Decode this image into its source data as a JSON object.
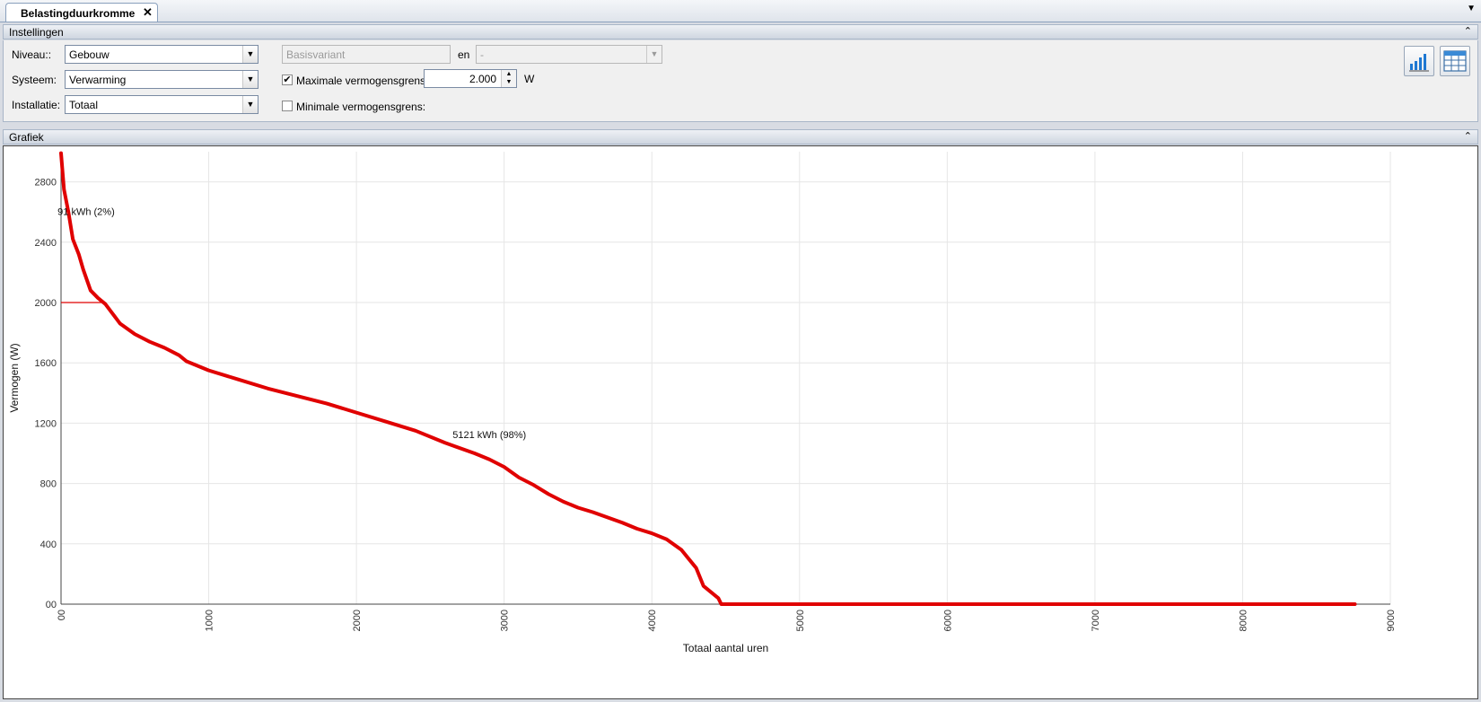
{
  "tab": {
    "label": "Belastingduurkromme",
    "close": "✕",
    "menu": "▼"
  },
  "settings": {
    "title": "Instellingen",
    "collapse": "⌃",
    "niveau_label": "Niveau::",
    "niveau_value": "Gebouw",
    "systeem_label": "Systeem:",
    "systeem_value": "Verwarming",
    "installatie_label": "Installatie:",
    "installatie_value": "Totaal",
    "variant_value": "Basisvariant",
    "en_label": "en",
    "compare_value": "-",
    "max_check_label": "Maximale vermogensgrens:",
    "max_checked": "✔",
    "max_value": "2.000",
    "unit": "W",
    "min_check_label": "Minimale vermogensgrens:"
  },
  "graph_panel": {
    "title": "Grafiek",
    "collapse": "⌃"
  },
  "chart_data": {
    "type": "line",
    "title": "",
    "xlabel": "Totaal aantal uren",
    "ylabel": "Vermogen (W)",
    "xlim": [
      0,
      9000
    ],
    "ylim": [
      0,
      3000
    ],
    "xticks": [
      0,
      1000,
      2000,
      3000,
      4000,
      5000,
      6000,
      7000,
      8000,
      9000
    ],
    "yticks": [
      0,
      400,
      800,
      1200,
      1600,
      2000,
      2400,
      2800
    ],
    "xtick_labels": [
      "00",
      "1000",
      "2000",
      "3000",
      "4000",
      "5000",
      "6000",
      "7000",
      "8000",
      "9000"
    ],
    "ytick_labels": [
      "00",
      "400",
      "800",
      "1200",
      "1600",
      "2000",
      "2400",
      "2800"
    ],
    "grid": true,
    "series": [
      {
        "color": "#e00000",
        "x": [
          0,
          20,
          50,
          80,
          120,
          150,
          200,
          250,
          300,
          400,
          500,
          600,
          700,
          800,
          850,
          900,
          1000,
          1200,
          1400,
          1600,
          1800,
          2000,
          2200,
          2400,
          2600,
          2800,
          2900,
          3000,
          3100,
          3200,
          3300,
          3400,
          3500,
          3600,
          3800,
          3900,
          4000,
          4100,
          4200,
          4300,
          4350,
          4400,
          4450,
          4470,
          4600,
          5000,
          6000,
          7000,
          8000,
          8760
        ],
        "y": [
          2990,
          2750,
          2600,
          2420,
          2320,
          2220,
          2080,
          2030,
          1990,
          1860,
          1790,
          1740,
          1700,
          1650,
          1610,
          1590,
          1550,
          1490,
          1430,
          1380,
          1330,
          1270,
          1210,
          1150,
          1070,
          1000,
          960,
          910,
          840,
          790,
          730,
          680,
          640,
          610,
          540,
          500,
          470,
          430,
          360,
          240,
          120,
          80,
          40,
          0,
          0,
          0,
          0,
          0,
          0,
          0
        ]
      }
    ],
    "threshold": {
      "y": 2000,
      "x_end": 300
    },
    "annotations": [
      {
        "text": "91 kWh (2%)",
        "x": 170,
        "y": 2580
      },
      {
        "text": "5121 kWh (98%)",
        "x": 2900,
        "y": 1100
      }
    ]
  }
}
